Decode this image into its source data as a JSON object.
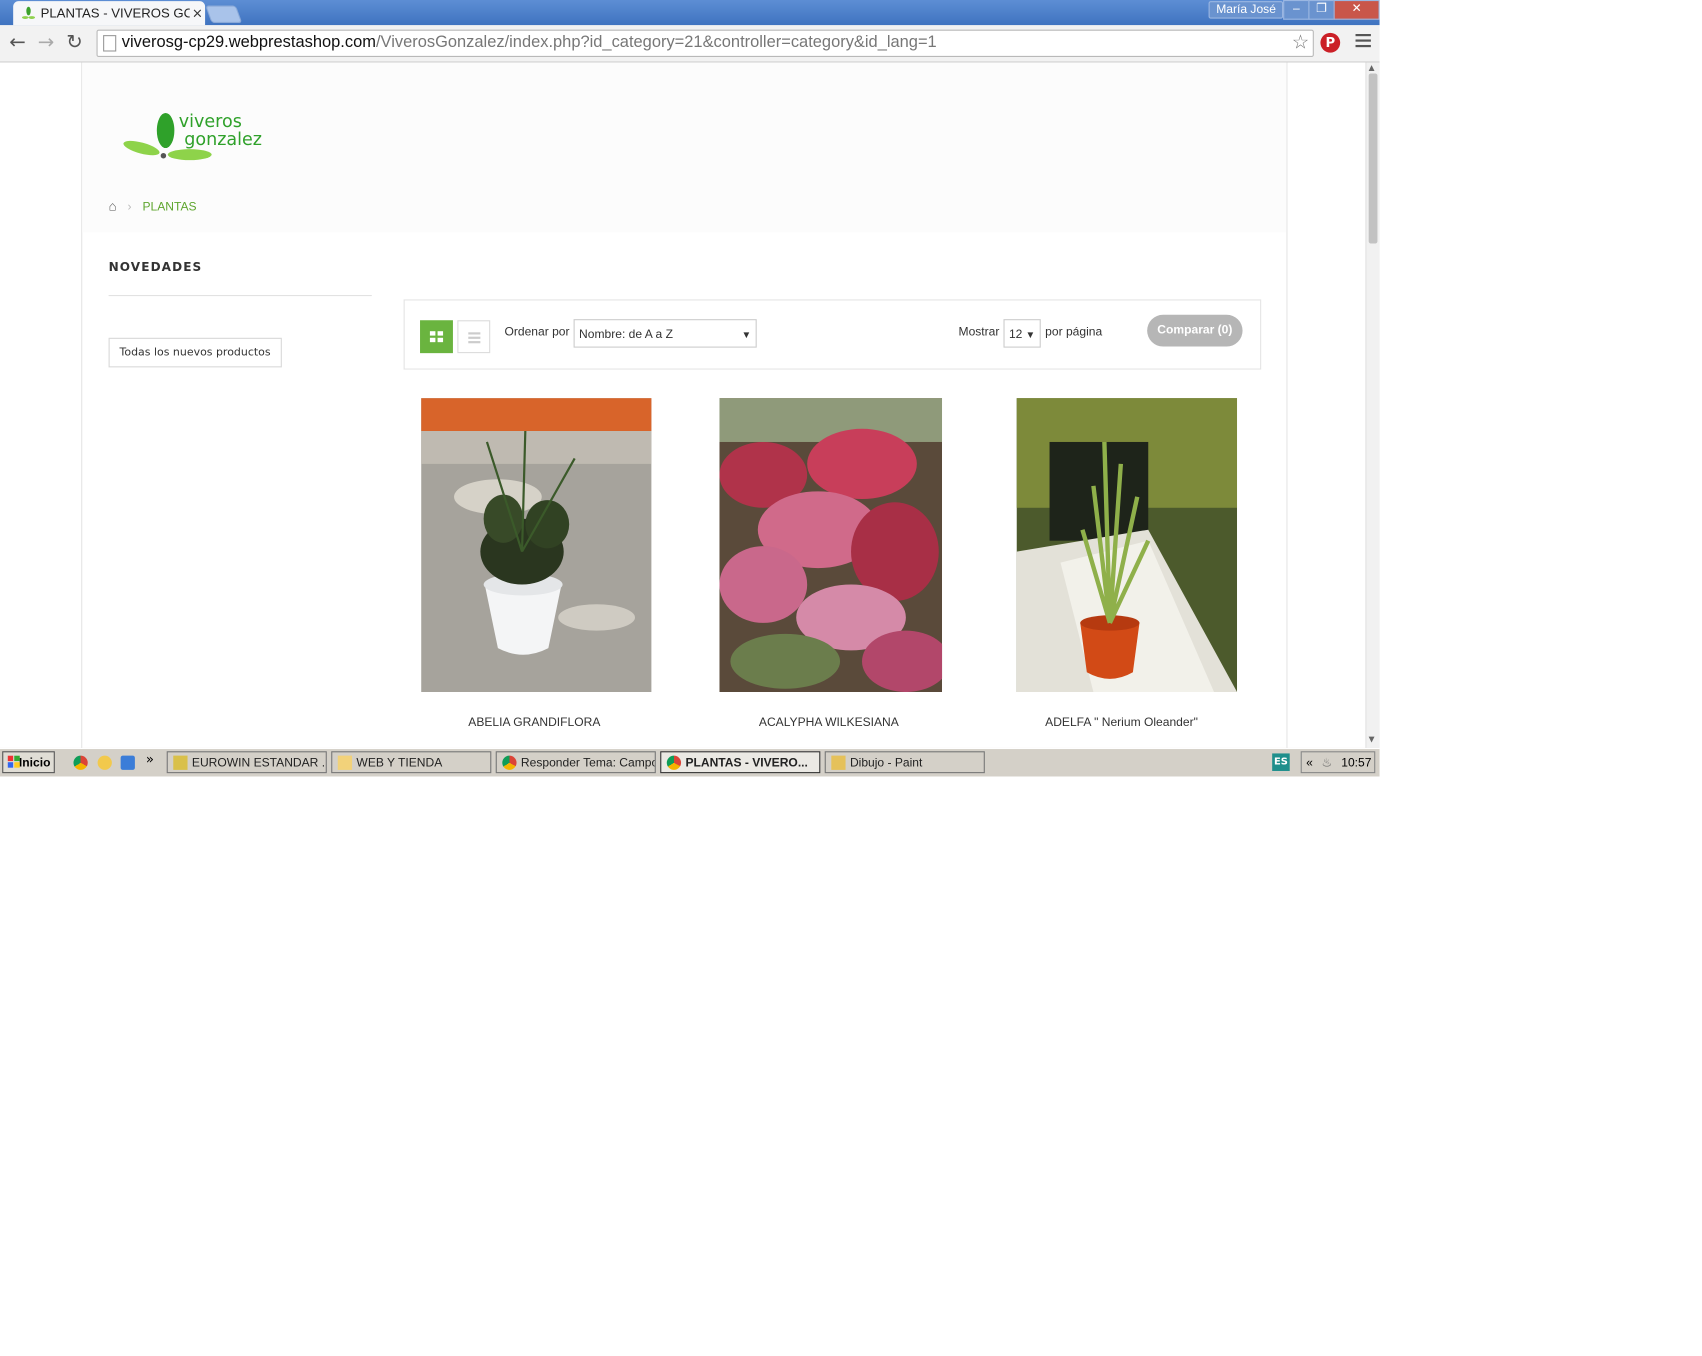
{
  "browser": {
    "tab_title": "PLANTAS - VIVEROS GONZ",
    "tab_close": "×",
    "user": "María José",
    "url_host": "viverosg-cp29.webprestashop.com",
    "url_rest": "/ViverosGonzalez/index.php?id_category=21&controller=category&id_lang=1"
  },
  "store": {
    "logo_line1": "viveros",
    "logo_line2": "gonzalez",
    "breadcrumb": {
      "current": "PLANTAS"
    },
    "sidebar": {
      "title": "NOVEDADES",
      "button": "Todas los nuevos productos"
    },
    "sortbar": {
      "sort_label": "Ordenar por",
      "sort_value": "Nombre: de A a Z",
      "show_label": "Mostrar",
      "show_value": "12",
      "per_page_label": "por página",
      "compare_label": "Comparar (0)"
    },
    "products": [
      {
        "name": "ABELIA GRANDIFLORA"
      },
      {
        "name": "ACALYPHA WILKESIANA"
      },
      {
        "name": "ADELFA \" Nerium Oleander\""
      }
    ]
  },
  "taskbar": {
    "start": "Inicio",
    "more": "»",
    "buttons": [
      "EUROWIN ESTANDAR ...",
      "WEB Y TIENDA",
      "Responder Tema: Campo...",
      "PLANTAS - VIVERO...",
      "Dibujo - Paint"
    ],
    "lang": "ES",
    "tray_arrow": "«",
    "clock": "10:57"
  },
  "colors": {
    "brand_green": "#6ab43f",
    "link_green": "#5fa62f"
  }
}
